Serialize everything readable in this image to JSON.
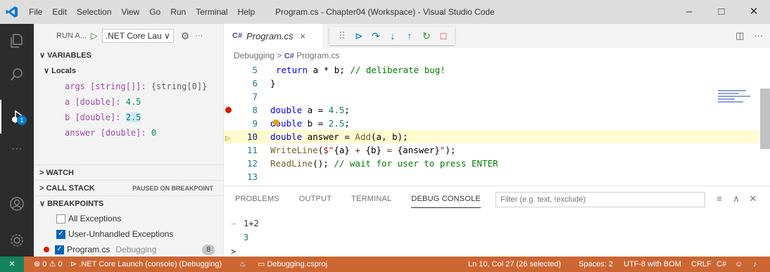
{
  "titlebar": {
    "menu": [
      "File",
      "Edit",
      "Selection",
      "View",
      "Go",
      "Run",
      "Terminal",
      "Help"
    ],
    "window_title": "Program.cs - Chapter04 (Workspace) - Visual Studio Code",
    "controls": [
      "–",
      "□",
      "✕"
    ]
  },
  "activity": {
    "debug_badge": "1"
  },
  "sidebar": {
    "run_label": "RUN A...",
    "config_name": ".NET Core Lau ∨",
    "gear": "⚙",
    "more": "···",
    "variables_header": "VARIABLES",
    "locals_header": "Locals",
    "variables": [
      {
        "name": "args [string[]]:",
        "value": "{string[0]}",
        "highlight": false
      },
      {
        "name": "a [double]:",
        "value": "4.5",
        "highlight": false
      },
      {
        "name": "b [double]:",
        "value": "2.5",
        "highlight": true
      },
      {
        "name": "answer [double]:",
        "value": "0",
        "highlight": false
      }
    ],
    "watch_header": "WATCH",
    "callstack_header": "CALL STACK",
    "callstack_status": "PAUSED ON BREAKPOINT",
    "breakpoints_header": "BREAKPOINTS",
    "breakpoints": [
      {
        "label": "All Exceptions",
        "checked": false
      },
      {
        "label": "User-Unhandled Exceptions",
        "checked": true
      }
    ],
    "program_bp": {
      "file": "Program.cs",
      "folder": "Debugging",
      "line": "8"
    }
  },
  "editor": {
    "tab_label": "Program.cs",
    "tab_close": "×",
    "cs_glyph": "C#",
    "breadcrumb_folder": "Debugging",
    "breadcrumb_sep": ">",
    "breadcrumb_file": "Program.cs",
    "split_icon": "◫",
    "more": "···",
    "lines": [
      {
        "num": "5",
        "text": "  return a * b; // deliberate bug!"
      },
      {
        "num": "6",
        "text": "}"
      },
      {
        "num": "7",
        "text": ""
      },
      {
        "num": "8",
        "text": "double a = 4.5;"
      },
      {
        "num": "9",
        "text": "double b = 2.5;"
      },
      {
        "num": "10",
        "text": "double answer = Add(a, b);"
      },
      {
        "num": "11",
        "text": "WriteLine($\"{a} + {b} = {answer}\");"
      },
      {
        "num": "12",
        "text": "ReadLine(); // wait for user to press ENTER"
      },
      {
        "num": "13",
        "text": ""
      }
    ]
  },
  "panel": {
    "tabs": [
      "PROBLEMS",
      "OUTPUT",
      "TERMINAL",
      "DEBUG CONSOLE"
    ],
    "filter_placeholder": "Filter (e.g. text, !exclude)",
    "console": [
      {
        "prefix": "→",
        "text": "1+2"
      },
      {
        "prefix": "",
        "text": "3"
      }
    ],
    "prompt": ">"
  },
  "status": {
    "remote_icon": "✕",
    "problems": "⊗ 0 ⚠ 0",
    "launch": ".NET Core Launch (console) (Debugging)",
    "project": "Debugging.csproj",
    "position": "Ln 10, Col 27 (26 selected)",
    "spaces": "Spaces: 2",
    "encoding": "UTF-8 with BOM",
    "eol": "CRLF",
    "language": "C#"
  },
  "colors": {
    "status_bg": "#cc6633",
    "activity_bg": "#2c2c2c",
    "current_line": "#fffbd1",
    "breakpoint": "#e51400"
  }
}
